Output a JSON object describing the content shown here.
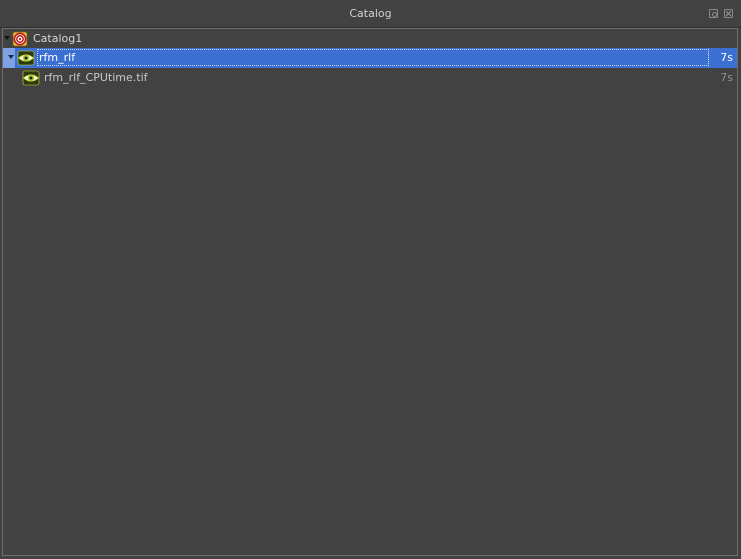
{
  "window": {
    "title": "Catalog",
    "buttons": [
      "float-icon",
      "close-icon"
    ]
  },
  "tree": {
    "root": {
      "label": "Catalog1",
      "icon": "catalog-target-icon",
      "expanded": true
    },
    "items": [
      {
        "label": "rfm_rlf",
        "time": "7s",
        "icon": "eye-icon",
        "selected": true,
        "expanded": true,
        "children": [
          {
            "label": "rfm_rlf_CPUtime.tif",
            "time": "7s",
            "icon": "eye-icon"
          }
        ]
      }
    ]
  },
  "colors": {
    "background": "#424242",
    "selection": "#3b6fd2",
    "text": "#d8d8d8",
    "dim_text": "#8e8e8e"
  }
}
